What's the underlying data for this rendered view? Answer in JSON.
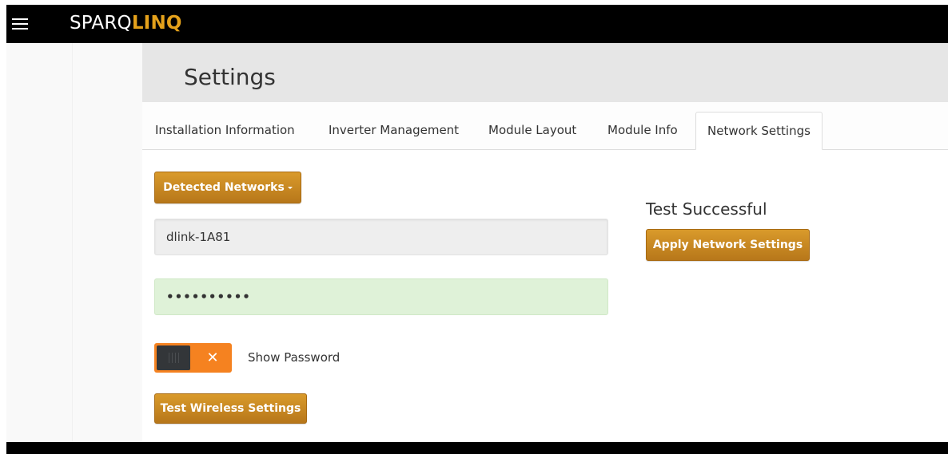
{
  "app": {
    "logo_part1": "SPARQ",
    "logo_part2": "LINQ",
    "menu_icon": "hamburger-menu-icon"
  },
  "header": {
    "title": "Settings"
  },
  "tabs": [
    {
      "label": "Installation Information",
      "active": false
    },
    {
      "label": "Inverter Management",
      "active": false
    },
    {
      "label": "Module Layout",
      "active": false
    },
    {
      "label": "Module Info",
      "active": false
    },
    {
      "label": "Network Settings",
      "active": true
    }
  ],
  "network": {
    "detected_networks_label": "Detected Networks",
    "ssid_value": "dlink-1A81",
    "password_value": "••••••••••",
    "show_password_label": "Show Password",
    "show_password_toggle": {
      "checked": false,
      "off_symbol": "✕"
    },
    "test_button_label": "Test Wireless Settings",
    "status_text": "Test Successful",
    "apply_button_label": "Apply Network Settings"
  },
  "colors": {
    "accent_gold": "#c8871f",
    "logo_highlight": "#e4a11b",
    "toggle_orange": "#f58220",
    "password_valid_bg": "#dff2d8",
    "topbar": "#000000"
  }
}
